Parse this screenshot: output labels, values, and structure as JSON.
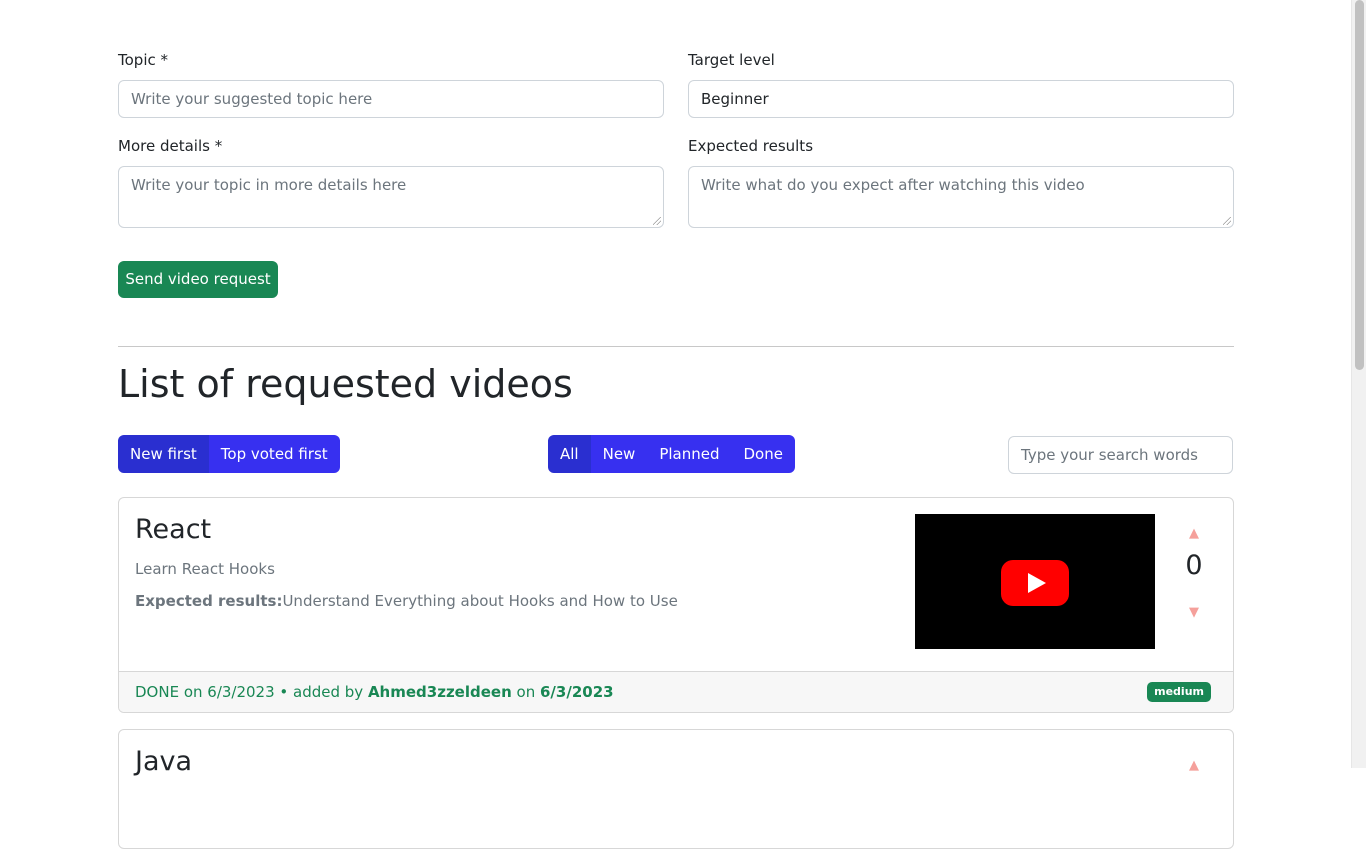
{
  "form": {
    "topic_label": "Topic *",
    "topic_placeholder": "Write your suggested topic here",
    "target_level_label": "Target level",
    "target_level_value": "Beginner",
    "details_label": "More details *",
    "details_placeholder": "Write your topic in more details here",
    "expected_label": "Expected results",
    "expected_placeholder": "Write what do you expect after watching this video",
    "submit_label": "Send video request"
  },
  "list": {
    "title": "List of requested videos",
    "sort_options": [
      "New first",
      "Top voted first"
    ],
    "sort_active": "New first",
    "filter_options": [
      "All",
      "New",
      "Planned",
      "Done"
    ],
    "filter_active": "All",
    "search_placeholder": "Type your search words"
  },
  "requests": [
    {
      "topic": "React",
      "details": "Learn React Hooks",
      "expected_label": "Expected results:",
      "expected": "Understand Everything about Hooks and How to Use",
      "votes": "0",
      "status_text": "DONE on 6/3/2023 • added by ",
      "author": "Ahmed3zzeldeen",
      "on_text": " on ",
      "date": "6/3/2023",
      "level": "medium"
    },
    {
      "topic": "Java"
    }
  ],
  "colors": {
    "primary": "#3730f0",
    "success": "#198754",
    "vote_arrow": "#f5a09b",
    "youtube_red": "#ff0000"
  },
  "icons": {
    "upvote": "triangle-up-icon",
    "downvote": "triangle-down-icon",
    "play": "youtube-play-icon"
  }
}
